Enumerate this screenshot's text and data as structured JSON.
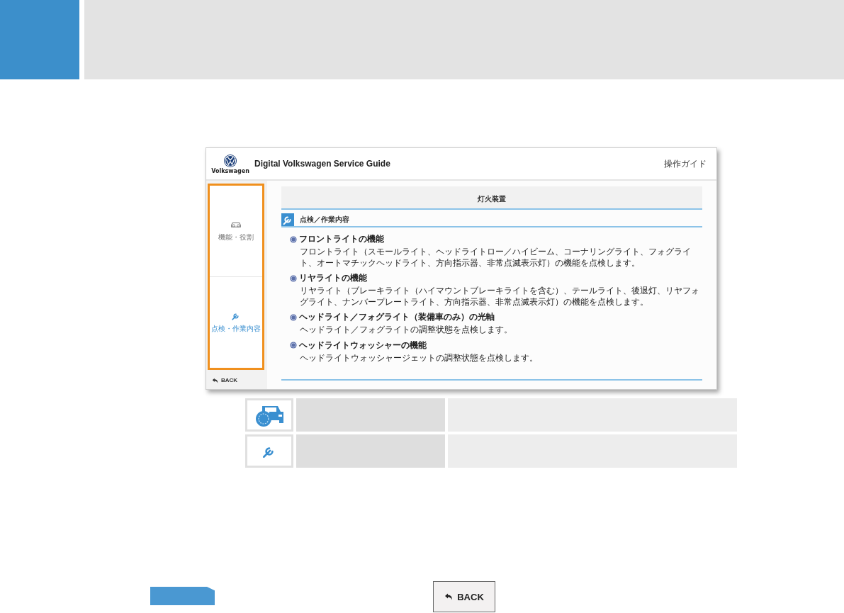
{
  "app": {
    "title": "Digital Volkswagen Service Guide",
    "logo_text": "Volkswagen",
    "guide_link": "操作ガイド",
    "sidebar": [
      {
        "kind": "car",
        "label": "機能・役割",
        "selected": false
      },
      {
        "kind": "wrench",
        "label": "点検・作業内容",
        "selected": true
      }
    ],
    "back": "BACK",
    "category": "灯火装置",
    "section": "点検／作業内容",
    "items": [
      {
        "title": "フロントライトの機能",
        "description": "フロントライト（スモールライト、ヘッドライトロー／ハイビーム、コーナリングライト、フォグライト、オートマチックヘッドライト、方向指示器、非常点滅表示灯）の機能を点検します。"
      },
      {
        "title": "リヤライトの機能",
        "description": "リヤライト（ブレーキライト（ハイマウントブレーキライトを含む）、テールライト、後退灯、リヤフォグライト、ナンバープレートライト、方向指示器、非常点滅表示灯）の機能を点検します。"
      },
      {
        "title": "ヘッドライト／フォグライト（装備車のみ）の光軸",
        "description": "ヘッドライト／フォグライトの調整状態を点検します。"
      },
      {
        "title": "ヘッドライトウォッシャーの機能",
        "description": "ヘッドライトウォッシャージェットの調整状態を点検します。"
      }
    ]
  },
  "legend_rows": [
    {
      "kind": "car"
    },
    {
      "kind": "wrench"
    }
  ],
  "back_button": "BACK"
}
